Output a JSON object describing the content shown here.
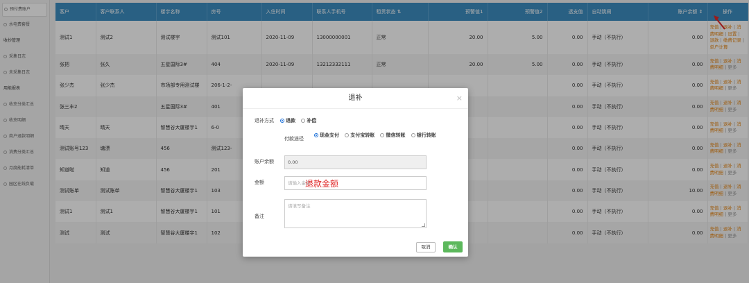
{
  "sidebar": {
    "active": "预付费账户",
    "items": [
      {
        "label": "水电费套餐",
        "group": false
      },
      {
        "label": "收抄管理",
        "group": true
      },
      {
        "label": "采集日志",
        "group": false
      },
      {
        "label": "未采集日志",
        "group": false
      },
      {
        "label": "用能报表",
        "group": true
      },
      {
        "label": "收支分类汇总",
        "group": false
      },
      {
        "label": "收支明细",
        "group": false
      },
      {
        "label": "商户退款明细",
        "group": false
      },
      {
        "label": "消费分类汇总",
        "group": false
      },
      {
        "label": "月度能耗清单",
        "group": false
      },
      {
        "label": "园区在线负载",
        "group": false
      }
    ]
  },
  "table": {
    "headers": [
      "客户",
      "客户联系人",
      "楼宇名称",
      "房号",
      "入住时间",
      "联系人手机号",
      "租赁状态 ⇅",
      "预警值1",
      "预警值2",
      "透支值",
      "自动跳闸",
      "账户余额 ⇕",
      "操作"
    ],
    "rows": [
      [
        "测试1",
        "测试2",
        "测试楼宇",
        "测试101",
        "2020-11-09",
        "13000000001",
        "正常",
        "20.00",
        "5.00",
        "0.00",
        "手动（不执行）",
        "0.00"
      ],
      [
        "张把",
        "张久",
        "五星国际3#",
        "404",
        "2020-11-09",
        "13212332111",
        "正常",
        "20.00",
        "5.00",
        "0.00",
        "手动（不执行）",
        "0.00"
      ],
      [
        "张少杰",
        "张少杰",
        "市场部专用测试楼",
        "206-1-2-",
        "",
        "",
        "",
        "",
        "",
        "0.00",
        "手动（不执行）",
        "0.00"
      ],
      [
        "张三丰2",
        "",
        "五星国际3#",
        "401",
        "",
        "",
        "",
        "",
        "",
        "0.00",
        "手动（不执行）",
        "0.00"
      ],
      [
        "晴天",
        "晴天",
        "智慧谷大厦楼宇1",
        "6-0",
        "",
        "",
        "",
        "",
        "",
        "0.00",
        "手动（不执行）",
        "0.00"
      ],
      [
        "测试账号123",
        "塘漂",
        "456",
        "测试123-",
        "",
        "",
        "",
        "",
        "",
        "0.00",
        "手动（不执行）",
        "0.00"
      ],
      [
        "知道啦",
        "知道",
        "456",
        "201",
        "",
        "",
        "",
        "",
        "",
        "0.00",
        "手动（不执行）",
        "0.00"
      ],
      [
        "测试账单",
        "测试账单",
        "智慧谷大厦楼宇1",
        "103",
        "",
        "",
        "",
        "",
        "",
        "0.00",
        "手动（不执行）",
        "10.00"
      ],
      [
        "测试1",
        "测试1",
        "智慧谷大厦楼宇1",
        "101",
        "",
        "",
        "",
        "",
        "",
        "0.00",
        "手动（不执行）",
        "0.00"
      ],
      [
        "测试",
        "测试",
        "智慧谷大厦楼宇1",
        "102",
        "",
        "",
        "",
        "",
        "",
        "0.00",
        "手动（不执行）",
        "0.00"
      ]
    ],
    "ops_full": {
      "recharge": "充值",
      "refund": "退补",
      "consume": "消费明细",
      "settings": "设置",
      "deduct": "退款",
      "history": "缴费记录",
      "calc": "单户计算"
    },
    "ops_short": {
      "recharge": "充值",
      "refund": "退补",
      "consume": "消费明细",
      "more": "更多"
    }
  },
  "dialog": {
    "title": "退补",
    "close_icon": "×",
    "method_label": "退补方式",
    "method_options": [
      "退款",
      "补偿"
    ],
    "pay_label": "付款途径",
    "pay_options": [
      "现金支付",
      "支付宝转账",
      "微信转账",
      "银行转账"
    ],
    "balance_label": "账户余额",
    "balance_value": "0.00",
    "amount_label": "金额",
    "amount_placeholder": "请输入金额",
    "remark_label": "备注",
    "remark_placeholder": "请填写备注",
    "cancel_label": "取消",
    "confirm_label": "确认",
    "annotation": "退款金额"
  }
}
